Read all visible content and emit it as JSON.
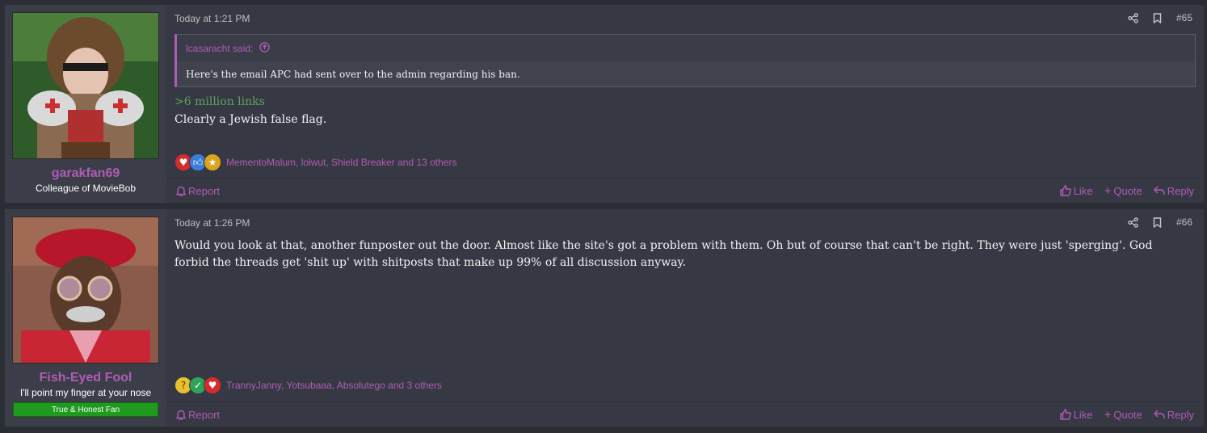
{
  "posts": [
    {
      "username": "garakfan69",
      "user_title": "Colleague of MovieBob",
      "timestamp": "Today at 1:21 PM",
      "post_number": "#65",
      "quote": {
        "author": "lcasaracht said:",
        "text": "Here's the email APC had sent over to the admin regarding his ban."
      },
      "greentext": ">6 million links",
      "body": "Clearly a Jewish false flag.",
      "reaction_icons": [
        "heart-icon",
        "thumbs-up-icon",
        "medal-icon"
      ],
      "reaction_users": "MementoMalum, lolwut, Shield Breaker and 13 others",
      "report_label": "Report",
      "like_label": "Like",
      "quote_label": "Quote",
      "reply_label": "Reply"
    },
    {
      "username": "Fish-Eyed Fool",
      "user_title": "I'll point my finger at your nose",
      "user_banner": "True & Honest Fan",
      "timestamp": "Today at 1:26 PM",
      "post_number": "#66",
      "body": "Would you look at that, another funposter out the door. Almost like the site's got a problem with them. Oh but of course that can't be right. They were just 'sperging'. God forbid the threads get 'shit up' with shitposts that make up 99% of all discussion anyway.",
      "reaction_icons": [
        "thinking-face-icon",
        "check-icon",
        "heart-icon"
      ],
      "reaction_users": "TrannyJanny, Yotsubaaa, Absolutego and 3 others",
      "report_label": "Report",
      "like_label": "Like",
      "quote_label": "Quote",
      "reply_label": "Reply"
    }
  ],
  "colors": {
    "accent": "#b05bb5",
    "greentext": "#5ea35e",
    "banner": "#1f9a1f",
    "post_bg": "#363943",
    "page_bg": "#2a2d34"
  }
}
